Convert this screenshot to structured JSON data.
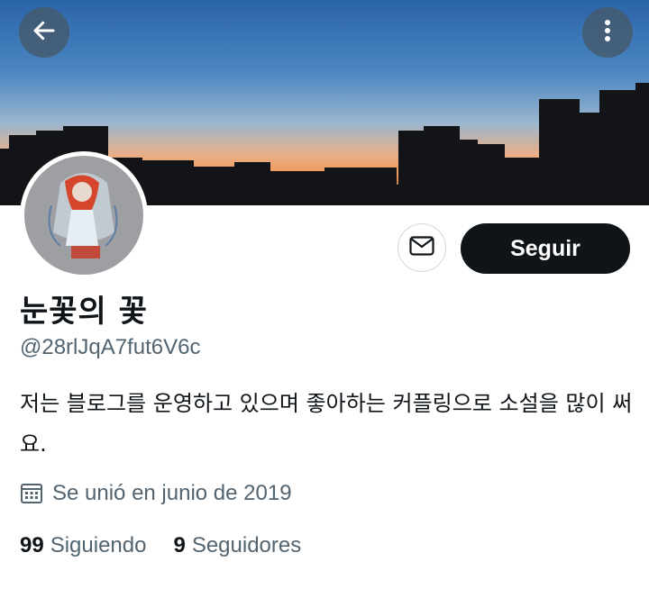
{
  "profile": {
    "name": "눈꽃의 꽃",
    "handle": "@28rlJqA7fut6V6c",
    "bio": "저는 블로그를 운영하고 있으며 좋아하는 커플링으로 소설을 많이 써요.",
    "joined": "Se unió en junio de 2019"
  },
  "actions": {
    "follow_label": "Seguir"
  },
  "stats": {
    "following_count": "99",
    "following_label": "Siguiendo",
    "followers_count": "9",
    "followers_label": "Seguidores"
  },
  "icons": {
    "back": "arrow-left-icon",
    "more": "more-vertical-icon",
    "message": "envelope-icon",
    "calendar": "calendar-icon"
  },
  "colors": {
    "follow_button": "#0f1419",
    "secondary_text": "#536471",
    "sky_top": "#2f6fb3",
    "sunset": "#f4a263"
  }
}
